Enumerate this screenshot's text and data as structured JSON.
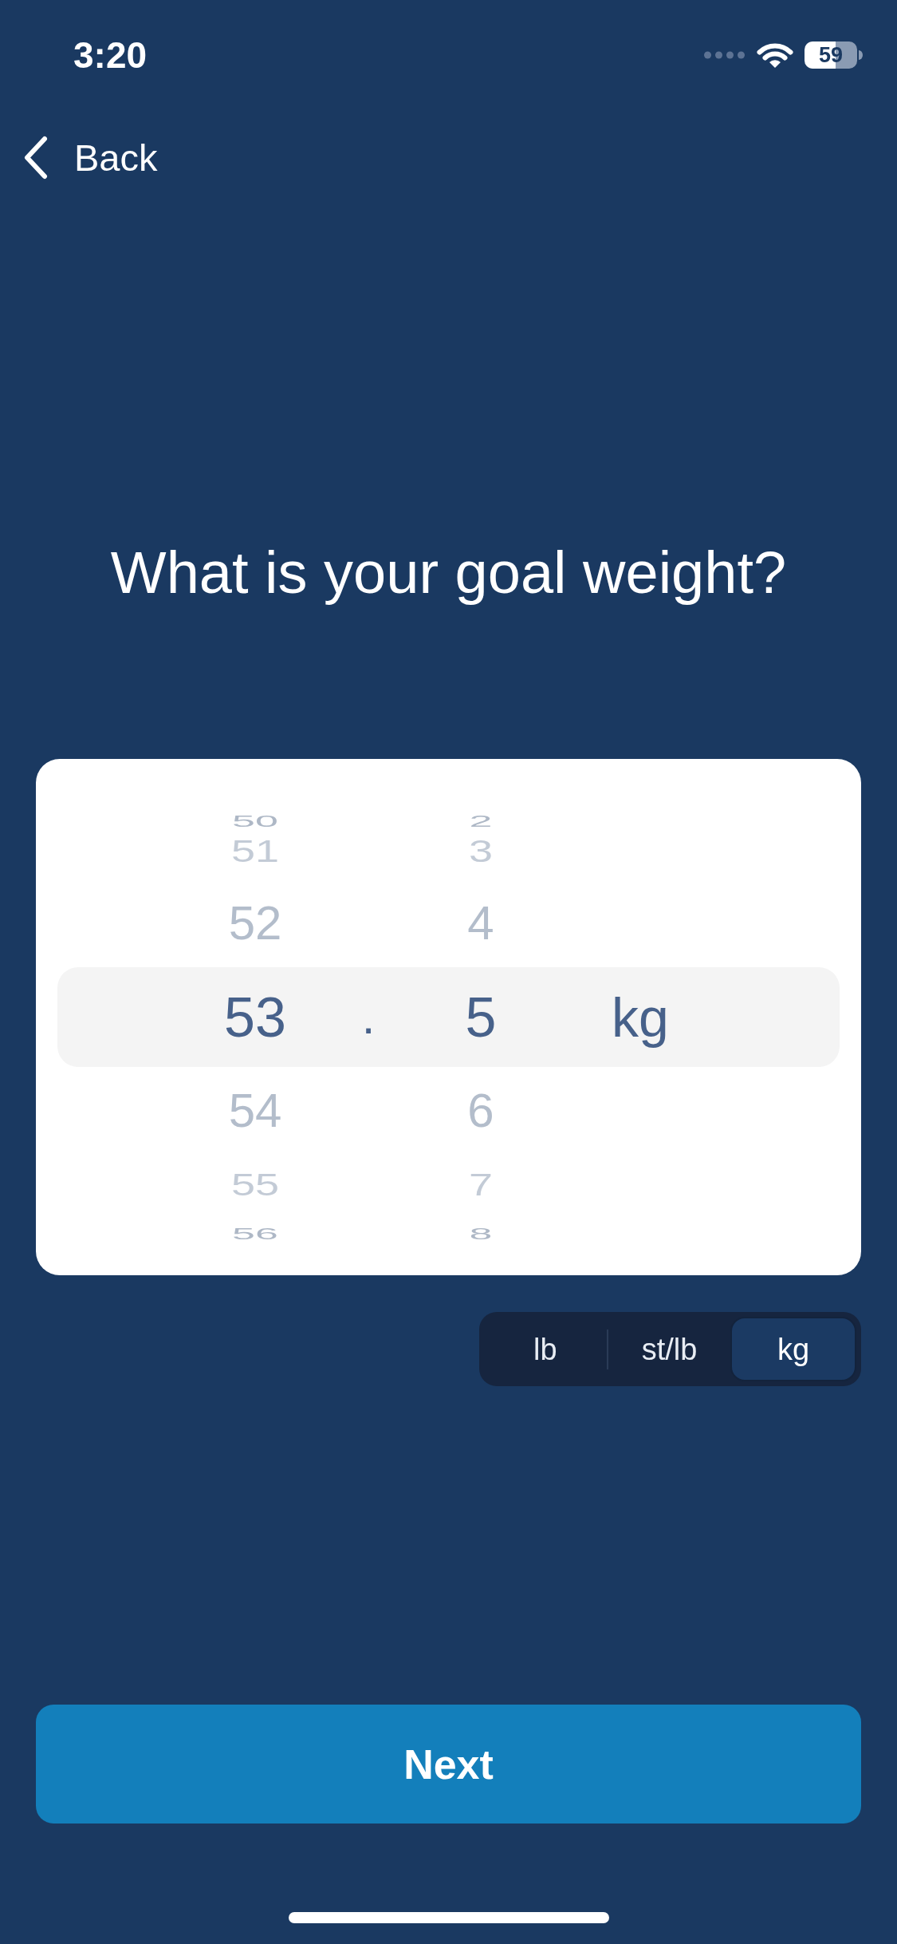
{
  "status_bar": {
    "time": "3:20",
    "battery": "59"
  },
  "nav": {
    "back": "Back"
  },
  "title": "What is your goal weight?",
  "picker": {
    "whole": [
      {
        "label": "50",
        "selected": false
      },
      {
        "label": "51",
        "selected": false
      },
      {
        "label": "52",
        "selected": false
      },
      {
        "label": "53",
        "selected": true
      },
      {
        "label": "54",
        "selected": false
      },
      {
        "label": "55",
        "selected": false
      },
      {
        "label": "56",
        "selected": false
      }
    ],
    "separator": ".",
    "decimal": [
      {
        "label": "2",
        "selected": false
      },
      {
        "label": "3",
        "selected": false
      },
      {
        "label": "4",
        "selected": false
      },
      {
        "label": "5",
        "selected": true
      },
      {
        "label": "6",
        "selected": false
      },
      {
        "label": "7",
        "selected": false
      },
      {
        "label": "8",
        "selected": false
      }
    ],
    "unit": "kg"
  },
  "unit_toggle": [
    {
      "label": "lb",
      "selected": false
    },
    {
      "label": "st/lb",
      "selected": false
    },
    {
      "label": "kg",
      "selected": true
    }
  ],
  "next_button": {
    "label": "Next"
  }
}
